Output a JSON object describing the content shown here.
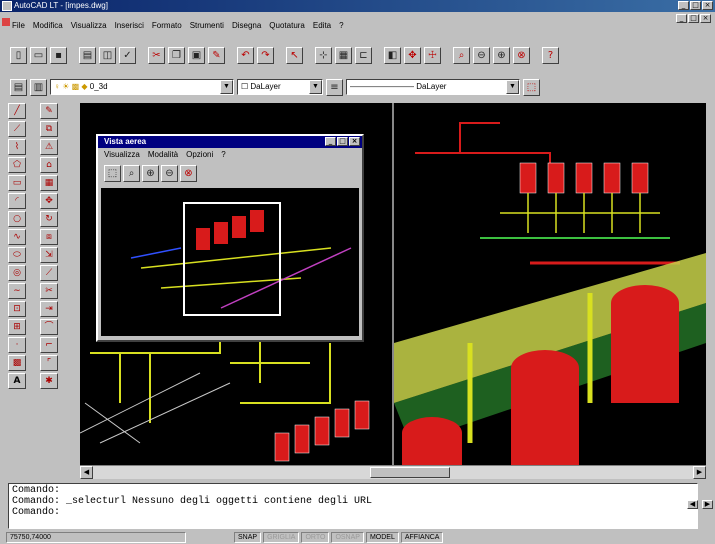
{
  "window": {
    "title": "AutoCAD LT - [impes.dwg]"
  },
  "menu": [
    "File",
    "Modifica",
    "Visualizza",
    "Inserisci",
    "Formato",
    "Strumenti",
    "Disegna",
    "Quotatura",
    "Edita",
    "?"
  ],
  "toolbar_std": [
    "new-icon",
    "open-icon",
    "save-icon",
    "print-icon",
    "preview-icon",
    "spell-icon",
    "cut-icon",
    "copy-icon",
    "paste-icon",
    "match-icon",
    "undo-icon",
    "redo-icon",
    "pick-icon",
    "snap-icon",
    "grid-icon",
    "ortho-icon",
    "tiled-icon",
    "zoom-icon",
    "pan-icon",
    "zoom-window-icon",
    "zoom-prev-icon",
    "zoom-all-icon",
    "help-icon"
  ],
  "layers": {
    "layer_value": "0_3d",
    "color_value": "DaLayer",
    "linetype_value": "DaLayer"
  },
  "aerial": {
    "title": "Vista aerea",
    "menu": [
      "Visualizza",
      "Modalità",
      "Opzioni",
      "?"
    ]
  },
  "command": {
    "lines": [
      "Comando:",
      "Comando: _selecturl Nessuno degli oggetti contiene degli URL",
      "Comando:"
    ]
  },
  "status": {
    "coords": "75750,74000",
    "toggles": [
      {
        "label": "SNAP",
        "on": true
      },
      {
        "label": "GRIGLIA",
        "on": false
      },
      {
        "label": "ORTO",
        "on": false
      },
      {
        "label": "OSNAP",
        "on": false
      },
      {
        "label": "MODEL",
        "on": true
      },
      {
        "label": "AFFIANCA",
        "on": true
      }
    ]
  },
  "colors": {
    "title_blue": "#0a246a",
    "canvas": "#000000",
    "tank_red": "#d81b1b",
    "pipe_yellow": "#d8e020",
    "pipe_green": "#3cc040"
  }
}
